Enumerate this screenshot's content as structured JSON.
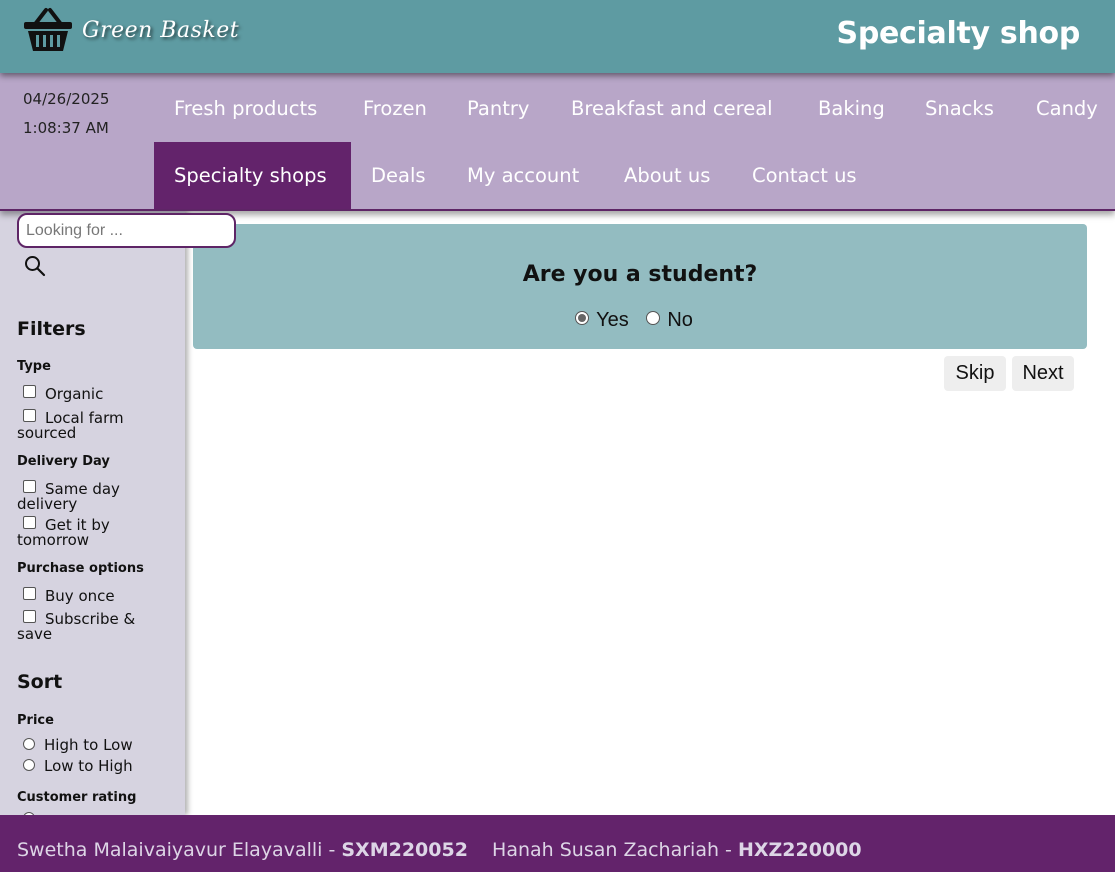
{
  "header": {
    "brand": "Green Basket",
    "page_title": "Specialty shop"
  },
  "nav": {
    "date": "04/26/2025",
    "time": "1:08:37 AM",
    "items": [
      {
        "label": "Fresh products"
      },
      {
        "label": "Frozen"
      },
      {
        "label": "Pantry"
      },
      {
        "label": "Breakfast and cereal"
      },
      {
        "label": "Baking"
      },
      {
        "label": "Snacks"
      },
      {
        "label": "Candy"
      },
      {
        "label": "Specialty shops",
        "active": true
      },
      {
        "label": "Deals"
      },
      {
        "label": "My account"
      },
      {
        "label": "About us"
      },
      {
        "label": "Contact us"
      }
    ]
  },
  "sidebar": {
    "search_placeholder": "Looking for ...",
    "filters_title": "Filters",
    "type_label": "Type",
    "type_options": [
      "Organic",
      "Local farm sourced"
    ],
    "delivery_label": "Delivery Day",
    "delivery_options": [
      "Same day delivery",
      "Get it by tomorrow"
    ],
    "purchase_label": "Purchase options",
    "purchase_options": [
      "Buy once",
      "Subscribe & save"
    ],
    "sort_title": "Sort",
    "price_label": "Price",
    "price_options": [
      "High to Low",
      "Low to High"
    ],
    "rating_label": "Customer rating"
  },
  "main": {
    "question": "Are you a student?",
    "answer_yes": "Yes",
    "answer_no": "No",
    "selected": "Yes",
    "skip_label": "Skip",
    "next_label": "Next"
  },
  "footer": {
    "author1_name": "Swetha Malaivaiyavur Elayavalli -",
    "author1_id": "SXM220052",
    "author2_name": "Hanah Susan Zachariah -",
    "author2_id": "HXZ220000"
  }
}
